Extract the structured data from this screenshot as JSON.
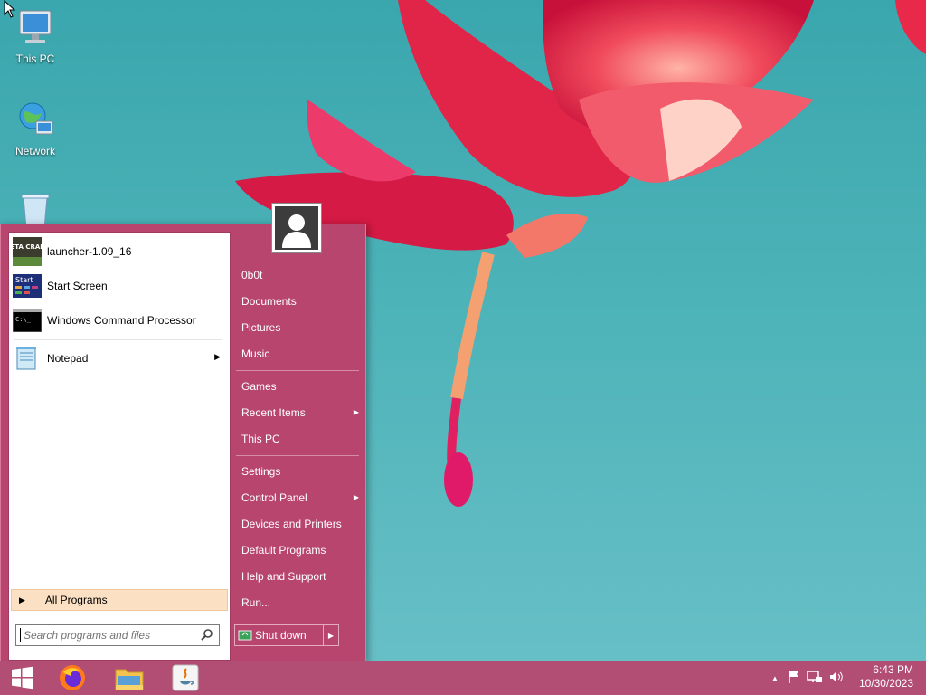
{
  "desktop": {
    "icons": [
      {
        "label": "This PC",
        "icon": "computer-icon"
      },
      {
        "label": "Network",
        "icon": "network-icon"
      },
      {
        "label": "",
        "icon": "recycle-bin-icon"
      }
    ]
  },
  "start_menu": {
    "pinned": [
      {
        "label": "launcher-1.09_16",
        "icon": "betacraft-icon",
        "icon_text": "BETA CRAFT"
      },
      {
        "label": "Start Screen",
        "icon": "start-screen-icon",
        "icon_text": "Start"
      },
      {
        "label": "Windows Command Processor",
        "icon": "cmd-icon",
        "icon_text": "C:\\_"
      }
    ],
    "recent": [
      {
        "label": "Notepad",
        "icon": "notepad-icon",
        "has_submenu": true
      }
    ],
    "all_programs": "All Programs",
    "search": {
      "placeholder": "Search programs and files",
      "value": ""
    },
    "user": "0b0t",
    "right_items_1": [
      {
        "label": "Documents"
      },
      {
        "label": "Pictures"
      },
      {
        "label": "Music"
      }
    ],
    "right_items_2": [
      {
        "label": "Games"
      },
      {
        "label": "Recent Items",
        "has_submenu": true
      },
      {
        "label": "This PC"
      }
    ],
    "right_items_3": [
      {
        "label": "Settings"
      },
      {
        "label": "Control Panel",
        "has_submenu": true
      },
      {
        "label": "Devices and Printers"
      },
      {
        "label": "Default Programs"
      },
      {
        "label": "Help and Support"
      },
      {
        "label": "Run..."
      }
    ],
    "shutdown": "Shut down"
  },
  "taskbar": {
    "apps": [
      "windows-start-icon",
      "firefox-icon",
      "file-explorer-icon",
      "java-icon"
    ],
    "tray_icons": [
      "show-hidden-icons-icon",
      "action-center-flag-icon",
      "network-tray-icon",
      "volume-icon"
    ],
    "time": "6:43 PM",
    "date": "10/30/2023"
  },
  "colors": {
    "accent": "#b7456d",
    "taskbar": "#b24e73",
    "all_programs_highlight": "#fbe0c3",
    "wallpaper_bg": "#4cb3b8",
    "flower": "#e8294a"
  }
}
